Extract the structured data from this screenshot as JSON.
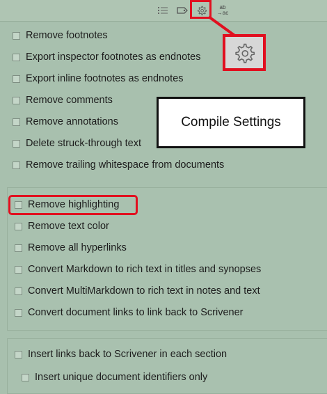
{
  "toolbar": {
    "icons": [
      "list-icon",
      "tag-icon",
      "gear-icon",
      "replace-icon"
    ],
    "replace_top": "ab",
    "replace_bottom": "→ac"
  },
  "callout": {
    "label": "Compile Settings"
  },
  "colors": {
    "highlight_red": "#e10f1f",
    "panel_bg": "#a8c0ae"
  },
  "group1": [
    "Remove footnotes",
    "Export inspector footnotes as endnotes",
    "Export inline footnotes as endnotes",
    "Remove comments",
    "Remove annotations",
    "Delete struck-through text",
    "Remove trailing whitespace from documents"
  ],
  "group2": [
    "Remove highlighting",
    "Remove text color",
    "Remove all hyperlinks",
    "Convert Markdown to rich text in titles and synopses",
    "Convert MultiMarkdown to rich text in notes and text",
    "Convert document links to link back to Scrivener"
  ],
  "group3": [
    "Insert links back to Scrivener in each section",
    "Insert unique document identifiers only"
  ]
}
